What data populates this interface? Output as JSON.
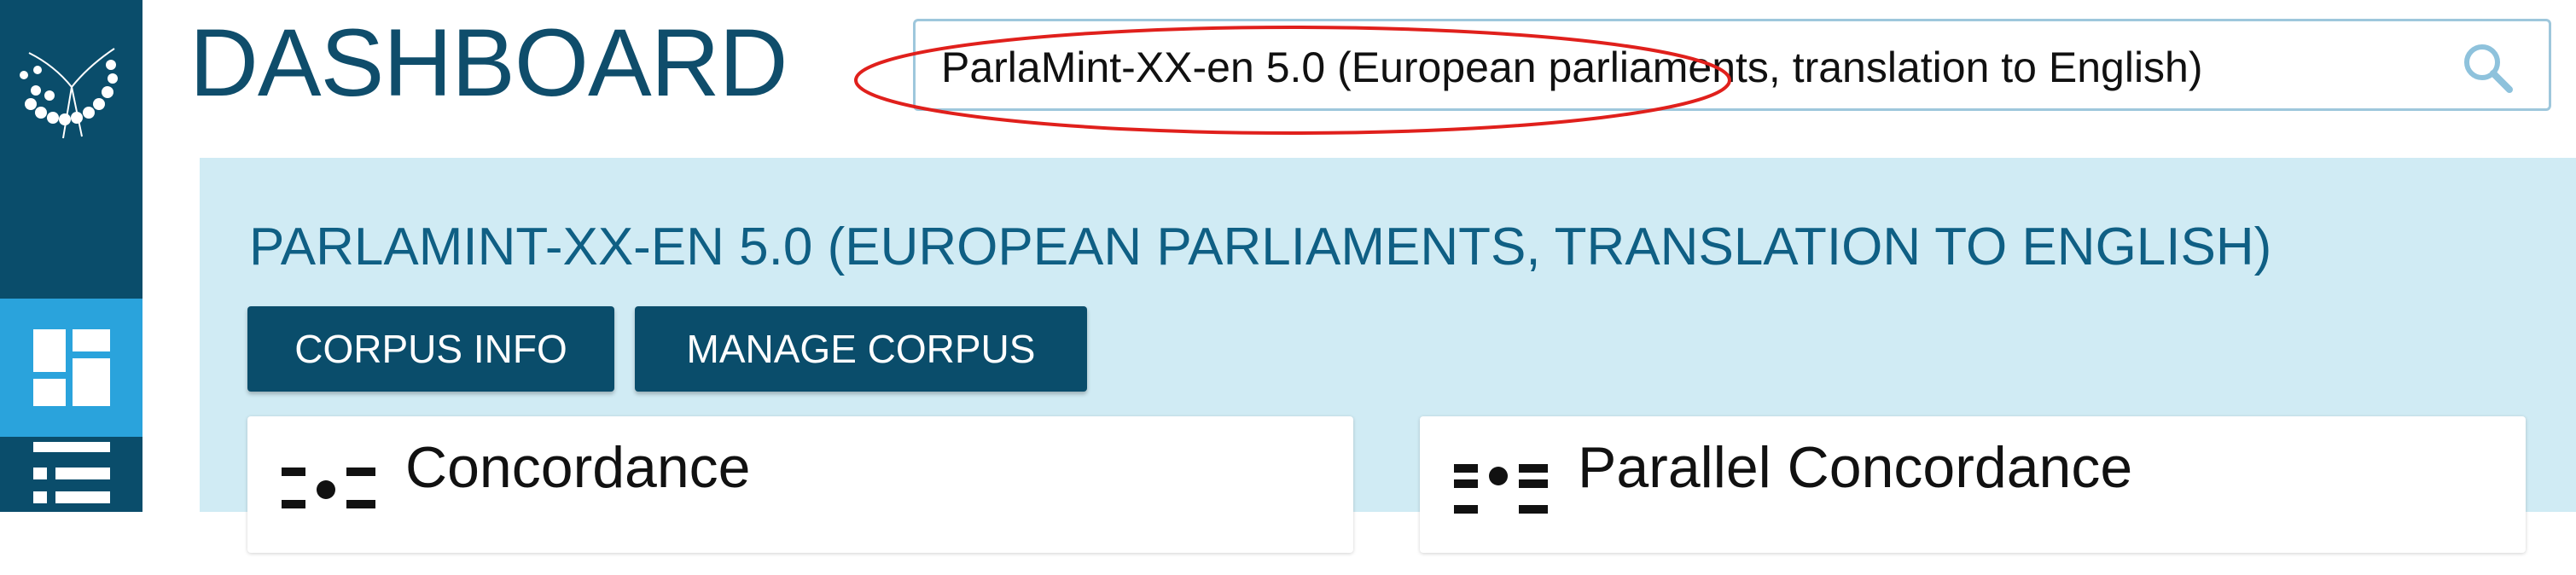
{
  "page": {
    "title": "DASHBOARD"
  },
  "search": {
    "value": "ParlaMint-XX-en 5.0 (European parliaments, translation to English)",
    "icon": "search-icon"
  },
  "annotation": {
    "color": "#e0201c"
  },
  "sidebar": {
    "items": [
      {
        "name": "dashboard",
        "icon": "dashboard-icon",
        "active": true
      },
      {
        "name": "list",
        "icon": "list-icon",
        "active": false
      }
    ]
  },
  "corpus": {
    "heading": "PARLAMINT-XX-EN 5.0 (EUROPEAN PARLIAMENTS, TRANSLATION TO ENGLISH)",
    "buttons": {
      "info_label": "CORPUS INFO",
      "manage_label": "MANAGE CORPUS"
    }
  },
  "cards": [
    {
      "title": "Concordance",
      "icon": "concordance-icon"
    },
    {
      "title": "Parallel Concordance",
      "icon": "parallel-concordance-icon"
    }
  ],
  "colors": {
    "sidebar": "#0a4d6b",
    "active": "#2aa3dc",
    "panel": "#d0ebf4",
    "button": "#0a4d6b",
    "heading": "#0f5f84"
  }
}
